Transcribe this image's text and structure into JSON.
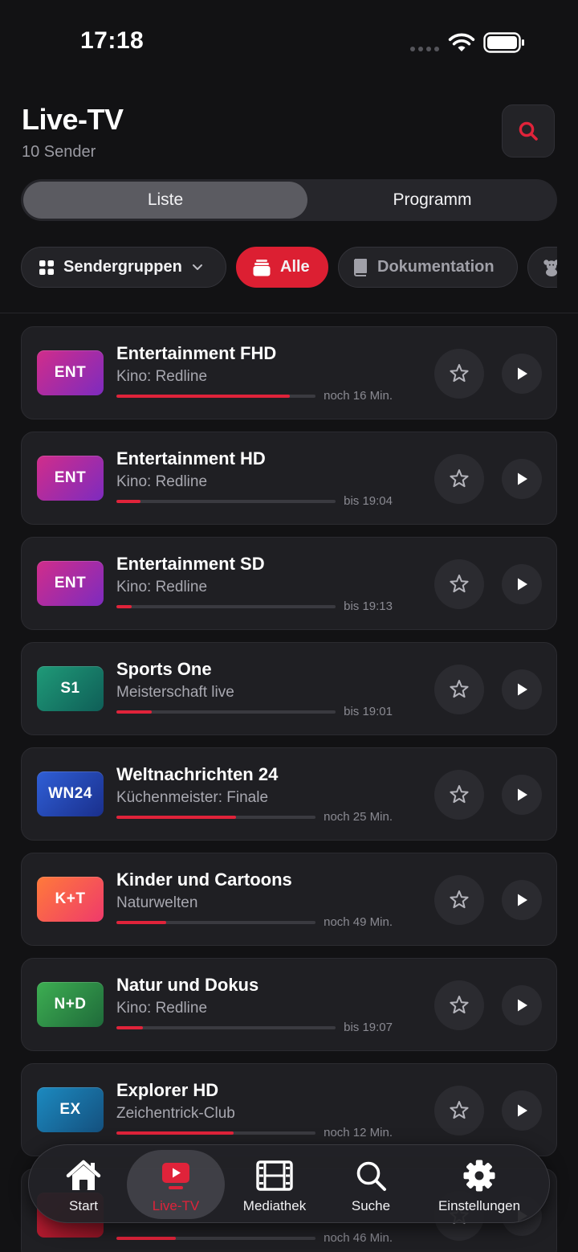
{
  "status_bar": {
    "time": "17:18"
  },
  "header": {
    "title": "Live-TV",
    "subtitle": "10 Sender"
  },
  "segments": {
    "list": "Liste",
    "program": "Programm"
  },
  "filters": {
    "groups": "Sendergruppen",
    "all": "Alle",
    "documentary": "Dokumentation"
  },
  "channels": [
    {
      "logo": "ENT",
      "name": "Entertainment FHD",
      "program": "Kino: Redline",
      "progress": 0.87,
      "time": "noch 16 Min.",
      "logo_colors": [
        "#d12d8a",
        "#7d2bbf"
      ]
    },
    {
      "logo": "ENT",
      "name": "Entertainment HD",
      "program": "Kino: Redline",
      "progress": 0.11,
      "time": "bis 19:04",
      "logo_colors": [
        "#d12d8a",
        "#7d2bbf"
      ]
    },
    {
      "logo": "ENT",
      "name": "Entertainment SD",
      "program": "Kino: Redline",
      "progress": 0.07,
      "time": "bis 19:13",
      "logo_colors": [
        "#d12d8a",
        "#7d2bbf"
      ]
    },
    {
      "logo": "S1",
      "name": "Sports One",
      "program": "Meisterschaft live",
      "progress": 0.16,
      "time": "bis 19:01",
      "logo_colors": [
        "#1f9a78",
        "#0f5e57"
      ]
    },
    {
      "logo": "WN24",
      "name": "Weltnachrichten 24",
      "program": "Küchenmeister: Finale",
      "progress": 0.6,
      "time": "noch 25 Min.",
      "logo_colors": [
        "#2f5fd6",
        "#1a2f8c"
      ]
    },
    {
      "logo": "K+T",
      "name": "Kinder und Cartoons",
      "program": "Naturwelten",
      "progress": 0.25,
      "time": "noch 49 Min.",
      "logo_colors": [
        "#ff7a3a",
        "#ef3a6b"
      ]
    },
    {
      "logo": "N+D",
      "name": "Natur und Dokus",
      "program": "Kino: Redline",
      "progress": 0.12,
      "time": "bis 19:07",
      "logo_colors": [
        "#3dae52",
        "#1f6a3a"
      ]
    },
    {
      "logo": "EX",
      "name": "Explorer HD",
      "program": "Zeichentrick-Club",
      "progress": 0.59,
      "time": "noch 12 Min.",
      "logo_colors": [
        "#1c8ac0",
        "#14507e"
      ]
    },
    {
      "logo": "",
      "name": "",
      "program": "",
      "progress": 0.3,
      "time": "noch 46 Min.",
      "logo_colors": [
        "#c81f35",
        "#8a1424"
      ]
    }
  ],
  "nav": {
    "home": "Start",
    "live": "Live-TV",
    "library": "Mediathek",
    "search": "Suche",
    "settings": "Einstellungen"
  },
  "colors": {
    "accent": "#e0233a",
    "background": "#121214",
    "card": "#1f1f23"
  }
}
